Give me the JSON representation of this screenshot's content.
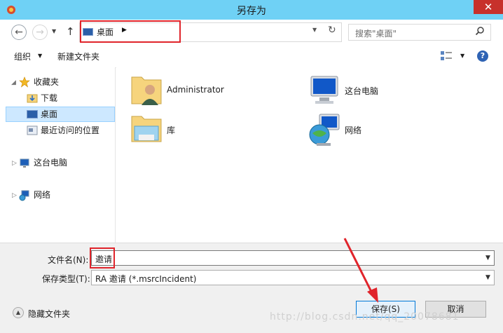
{
  "window": {
    "title": "另存为",
    "close_label": "✕"
  },
  "address": {
    "location": "桌面",
    "separator": "▶"
  },
  "search": {
    "placeholder": "搜索\"桌面\""
  },
  "toolbar": {
    "organize_label": "组织",
    "new_folder_label": "新建文件夹"
  },
  "nav_tree": {
    "favorites": {
      "label": "收藏夹",
      "children": [
        "下载",
        "桌面",
        "最近访问的位置"
      ]
    },
    "this_pc": "这台电脑",
    "network": "网络"
  },
  "content": {
    "items": [
      "Administrator",
      "这台电脑",
      "库",
      "网络"
    ]
  },
  "bottom": {
    "filename_label": "文件名(N):",
    "filename_value": "邀请",
    "filetype_label": "保存类型(T):",
    "filetype_value": "RA 邀请 (*.msrcIncident)",
    "hide_folders_label": "隐藏文件夹",
    "save_label": "保存(S)",
    "cancel_label": "取消"
  },
  "watermark": "http://blog.csdn.net/qq_20078681",
  "colors": {
    "titlebar": "#6fd1f5",
    "close_button": "#c7312b",
    "highlight_box": "#e0242b",
    "selection": "#cde8ff",
    "primary_button_border": "#0078d7"
  }
}
